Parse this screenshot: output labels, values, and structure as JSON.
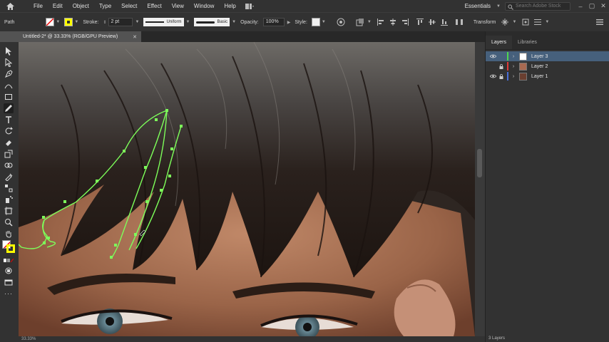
{
  "menubar": {
    "items": [
      "File",
      "Edit",
      "Object",
      "Type",
      "Select",
      "Effect",
      "View",
      "Window",
      "Help"
    ],
    "workspace": "Essentials",
    "search_placeholder": "Search Adobe Stock"
  },
  "controlbar": {
    "selection_label": "Path",
    "stroke_label": "Stroke:",
    "stroke_weight": "2 pt",
    "variable_width": "Uniform",
    "brush": "Basic",
    "opacity_label": "Opacity:",
    "opacity_value": "100%",
    "style_label": "Style:",
    "transform_label": "Transform",
    "fill_color": "#ffffff",
    "stroke_color": "#ffff00"
  },
  "document": {
    "tab_title": "Untitled-2* @ 33.33% (RGB/GPU Preview)",
    "close_glyph": "✕",
    "zoom": "33.33%"
  },
  "layers_panel": {
    "tabs": [
      "Layers",
      "Libraries"
    ],
    "layers": [
      {
        "name": "Layer 3",
        "color": "#4fd64f",
        "selected": true
      },
      {
        "name": "Layer 2",
        "color": "#e03a3a",
        "selected": false
      },
      {
        "name": "Layer 1",
        "color": "#4a6ed8",
        "selected": false
      }
    ],
    "footer": "3 Layers"
  },
  "colors": {
    "path_color": "#7dff5a",
    "selection_blue": "#46607c"
  }
}
